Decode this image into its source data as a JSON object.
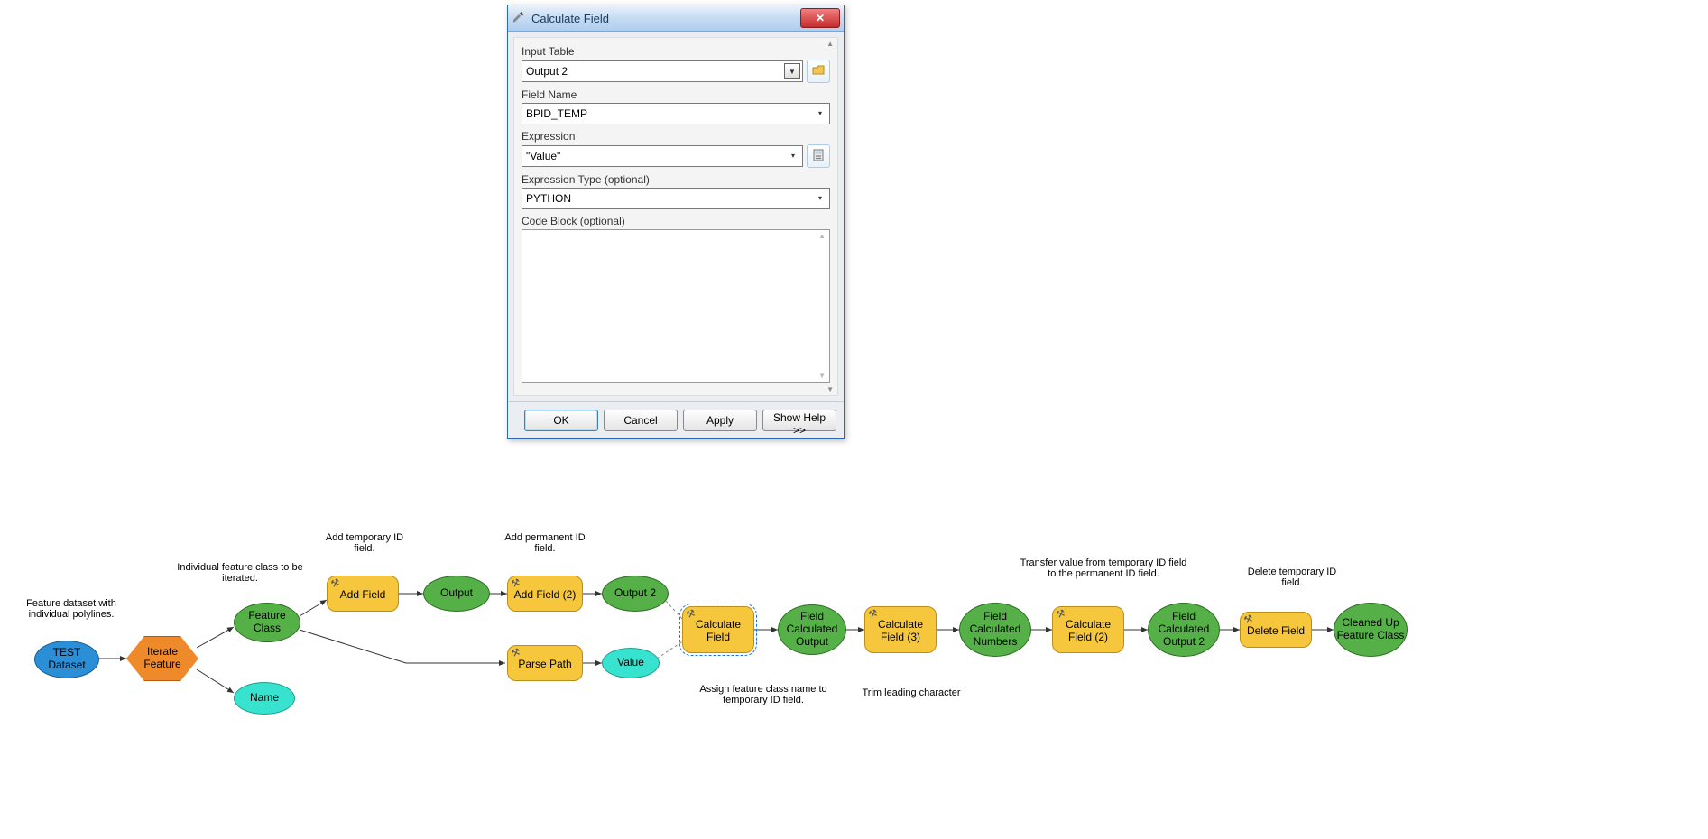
{
  "dialog": {
    "title": "Calculate Field",
    "fields": {
      "input_table_label": "Input Table",
      "input_table_value": "Output 2",
      "field_name_label": "Field Name",
      "field_name_value": "BPID_TEMP",
      "expression_label": "Expression",
      "expression_value": "\"Value\"",
      "expr_type_label": "Expression Type (optional)",
      "expr_type_value": "PYTHON",
      "code_block_label": "Code Block (optional)",
      "code_block_value": ""
    },
    "buttons": {
      "ok": "OK",
      "cancel": "Cancel",
      "apply": "Apply",
      "help": "Show Help >>"
    }
  },
  "flow": {
    "captions": {
      "dataset": "Feature dataset with individual polylines.",
      "iterate": "Individual feature class to be iterated.",
      "add_temp": "Add temporary ID field.",
      "add_perm": "Add permanent ID field.",
      "assign": "Assign feature class name to temporary ID field.",
      "trim": "Trim leading character",
      "transfer": "Transfer value from temporary ID field to the permanent ID field.",
      "delete": "Delete temporary ID field."
    },
    "nodes": {
      "test_dataset": "TEST Dataset",
      "iterate_feature": "Iterate Feature",
      "feature_class": "Feature Class",
      "name": "Name",
      "add_field": "Add Field",
      "output": "Output",
      "add_field_2": "Add Field (2)",
      "output_2": "Output 2",
      "parse_path": "Parse Path",
      "value": "Value",
      "calc_field": "Calculate Field",
      "field_calc_output": "Field Calculated Output",
      "calc_field_3": "Calculate Field (3)",
      "field_calc_numbers": "Field Calculated Numbers",
      "calc_field_2": "Calculate Field (2)",
      "field_calc_output2": "Field Calculated Output 2",
      "delete_field": "Delete Field",
      "cleaned_up": "Cleaned Up Feature Class"
    }
  }
}
